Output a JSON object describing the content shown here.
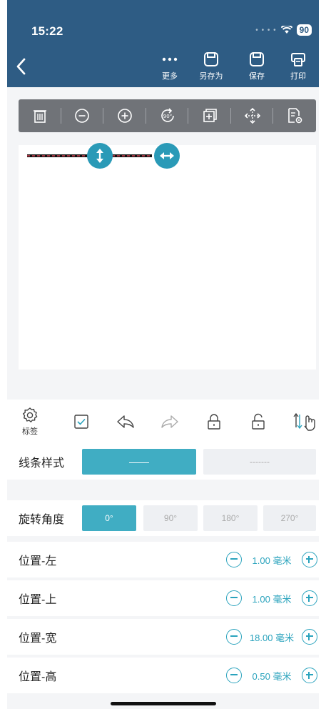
{
  "status": {
    "time": "15:22",
    "battery": "90"
  },
  "header": {
    "toolbar": [
      {
        "name": "more",
        "label": "更多",
        "icon": "more-icon"
      },
      {
        "name": "save-as",
        "label": "另存为",
        "icon": "save-as-icon"
      },
      {
        "name": "save",
        "label": "保存",
        "icon": "save-icon"
      },
      {
        "name": "print",
        "label": "打印",
        "icon": "print-icon"
      }
    ]
  },
  "editor_bar": [
    "trash-icon",
    "zoom-out-icon",
    "zoom-in-icon",
    "rotate-90-icon",
    "layer-add-icon",
    "move-icon",
    "doc-settings-icon"
  ],
  "action_bar": {
    "label_settings": "标签",
    "items": [
      "gear-icon",
      "checkbox-icon",
      "undo-icon",
      "redo-icon",
      "lock-icon",
      "unlock-icon",
      "sort-touch-icon"
    ]
  },
  "line_style": {
    "label": "线条样式",
    "solid": "——",
    "dashed": "-------",
    "selected": "solid"
  },
  "rotation": {
    "label": "旋转角度",
    "options": [
      "0°",
      "90°",
      "180°",
      "270°"
    ],
    "selected": "0°"
  },
  "fields": [
    {
      "label": "位置-左",
      "value": "1.00 毫米"
    },
    {
      "label": "位置-上",
      "value": "1.00 毫米"
    },
    {
      "label": "位置-宽",
      "value": "18.00 毫米"
    },
    {
      "label": "位置-高",
      "value": "0.50 毫米"
    }
  ],
  "colors": {
    "header": "#2e5c84",
    "accent": "#40adc3",
    "toolbar": "#707378"
  }
}
